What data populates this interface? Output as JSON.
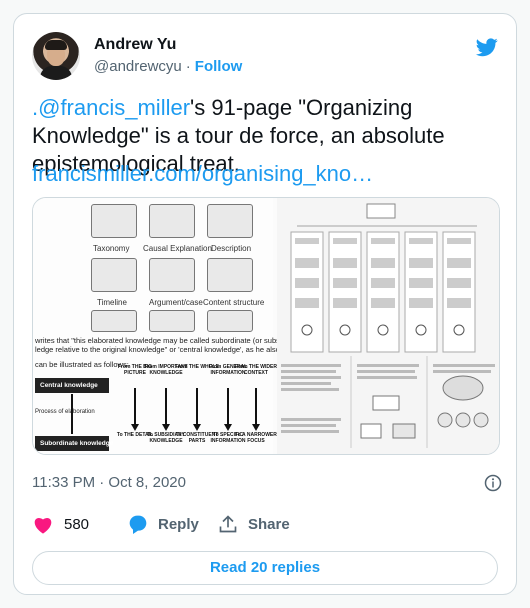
{
  "author": {
    "name": "Andrew Yu",
    "handle": "@andrewcyu",
    "separator": "·",
    "follow_label": "Follow"
  },
  "tweet": {
    "mention": ".@francis_miller",
    "text_rest": "'s 91-page \"Organizing Knowledge\" is a tour de force, an absolute epistemological treat.",
    "link": "francismiller.com/organising_kno…"
  },
  "media": {
    "thumbnails": [
      "Taxonomy",
      "Causal Explanation",
      "Description",
      "Timeline",
      "Argument/case",
      "Content structure"
    ],
    "quote_line1": "writes that \"this elaborated knowledge may be called subordinate (or subsumed)",
    "quote_line2": "ledge relative to the original knowledge\" or 'central knowledge', as he also calls it.",
    "illustrated": "can be illustrated as follows:",
    "central_knowledge": "Central knowledge",
    "process": "Process of elaboration",
    "subordinate_knowledge": "Subordinate knowledge",
    "columns": [
      {
        "from": "From THE BIG PICTURE",
        "to": "To THE DETAIL"
      },
      {
        "from": "From IMPORTANT KNOWLEDGE",
        "to": "To SUBSIDIARY KNOWLEDGE"
      },
      {
        "from": "From THE WHOLE",
        "to": "To CONSTITUENT PARTS"
      },
      {
        "from": "From GENERAL INFORMATION",
        "to": "To SPECIFIC INFORMATION"
      },
      {
        "from": "From THE WIDER CONTEXT",
        "to": "To A NARROWER FOCUS"
      }
    ]
  },
  "timestamp": "11:33 PM · Oct 8, 2020",
  "actions": {
    "likes": "580",
    "reply_label": "Reply",
    "share_label": "Share"
  },
  "read_replies": "Read 20 replies",
  "colors": {
    "accent": "#1d9bf0",
    "like": "#f91880",
    "text": "#0f1419",
    "muted": "#536471"
  }
}
